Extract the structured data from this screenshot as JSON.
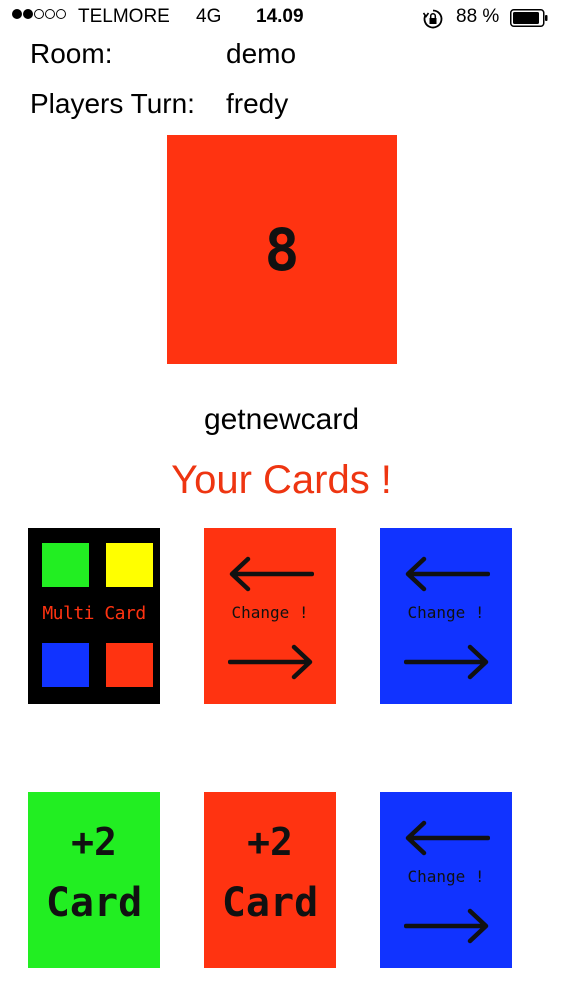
{
  "status_bar": {
    "carrier": "TELMORE",
    "network": "4G",
    "time": "14.09",
    "battery_percent": "88 %",
    "signal_bars_filled": 2,
    "signal_bars_total": 5
  },
  "game": {
    "room_label": "Room:",
    "room_value": "demo",
    "turn_label": "Players Turn:",
    "turn_value": "fredy",
    "pile_card": {
      "value": "8",
      "color": "#ff3311"
    },
    "get_new_card": "getnewcard",
    "your_cards_title": "Your Cards !"
  },
  "hand": [
    {
      "type": "multi",
      "label": "Multi Card",
      "color": "#000000"
    },
    {
      "type": "change",
      "label": "Change !",
      "color": "#ff3311"
    },
    {
      "type": "change",
      "label": "Change !",
      "color": "#1133ff"
    },
    {
      "type": "plus2",
      "top": "+2",
      "bottom": "Card",
      "color": "#22ee22"
    },
    {
      "type": "plus2",
      "top": "+2",
      "bottom": "Card",
      "color": "#ff3311"
    },
    {
      "type": "change",
      "label": "Change !",
      "color": "#1133ff"
    }
  ],
  "colors": {
    "accent_red": "#ee3511",
    "green": "#22ee22",
    "yellow": "#ffff00",
    "blue": "#1133ff",
    "red": "#ff3311"
  }
}
